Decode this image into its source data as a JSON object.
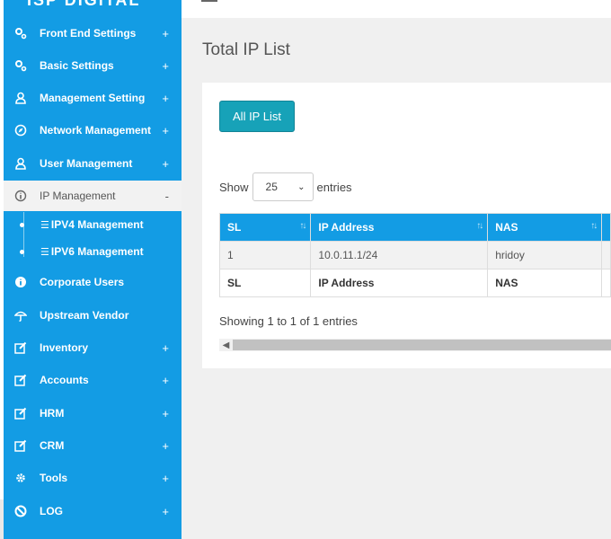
{
  "sidebar": {
    "brand": "ISP DIGITAL",
    "items": [
      {
        "label": "Front End Settings",
        "icon": "gears-icon",
        "expander": "+"
      },
      {
        "label": "Basic Settings",
        "icon": "gears-icon",
        "expander": "+"
      },
      {
        "label": "Management Setting",
        "icon": "user-icon",
        "expander": "+"
      },
      {
        "label": "Network Management",
        "icon": "compass-icon",
        "expander": "+"
      },
      {
        "label": "User Management",
        "icon": "user-icon",
        "expander": "+"
      },
      {
        "label": "IP Management",
        "icon": "info-icon",
        "expander": "-"
      },
      {
        "label": "Corporate Users",
        "icon": "info-icon",
        "expander": ""
      },
      {
        "label": "Upstream Vendor",
        "icon": "umbrella-icon",
        "expander": ""
      },
      {
        "label": "Inventory",
        "icon": "edit-icon",
        "expander": "+"
      },
      {
        "label": "Accounts",
        "icon": "edit-icon",
        "expander": "+"
      },
      {
        "label": "HRM",
        "icon": "edit-icon",
        "expander": "+"
      },
      {
        "label": "CRM",
        "icon": "edit-icon",
        "expander": "+"
      },
      {
        "label": "Tools",
        "icon": "cog-icon",
        "expander": "+"
      },
      {
        "label": "LOG",
        "icon": "ban-icon",
        "expander": "+"
      }
    ],
    "subitems": [
      {
        "label": "IPV4 Management"
      },
      {
        "label": "IPV6 Management"
      }
    ]
  },
  "page": {
    "title": "Total IP List",
    "all_ip_button": "All IP List"
  },
  "table_controls": {
    "show_label": "Show",
    "entries_label": "entries",
    "page_length": "25"
  },
  "table": {
    "headers": [
      "SL",
      "IP Address",
      "NAS"
    ],
    "rows": [
      [
        "1",
        "10.0.11.1/24",
        "hridoy"
      ]
    ],
    "footer": [
      "SL",
      "IP Address",
      "NAS"
    ],
    "info": "Showing 1 to 1 of 1 entries"
  },
  "colors": {
    "sidebar": "#139ce4",
    "button": "#17a2b8",
    "link": "#2a7ae2"
  }
}
